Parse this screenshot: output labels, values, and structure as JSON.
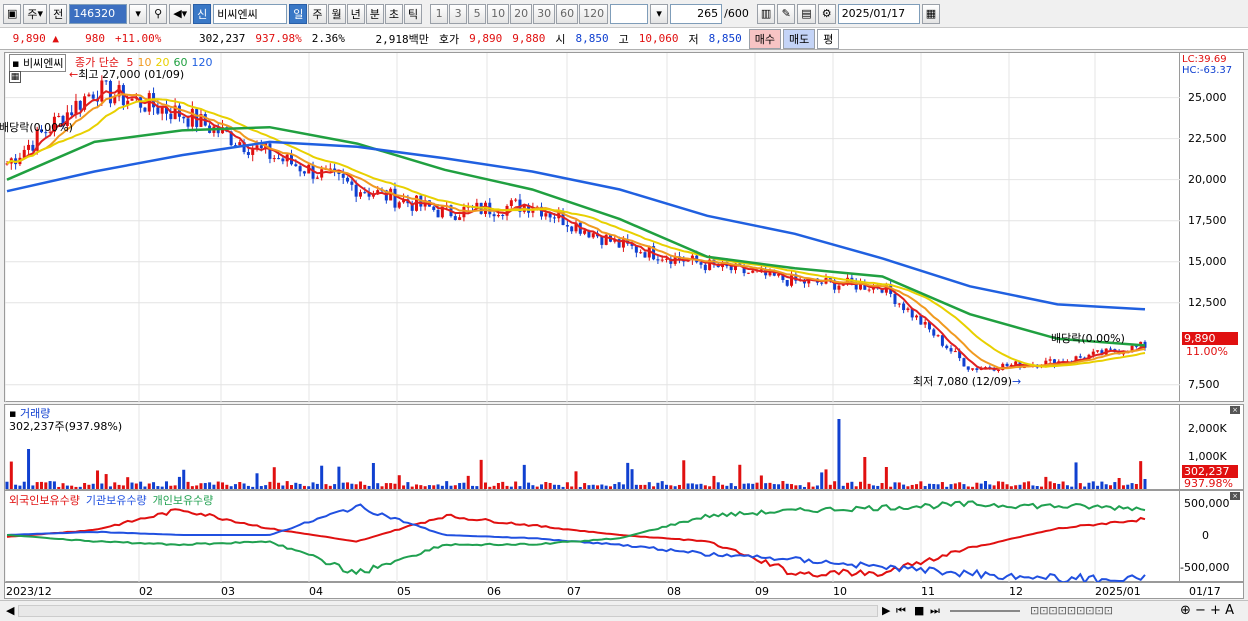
{
  "toolbar": {
    "market": "주",
    "prev_label": "전",
    "code": "146320",
    "badge": "신",
    "stock_name": "비씨엔씨",
    "periods": [
      "일",
      "주",
      "월",
      "년",
      "분",
      "초",
      "틱"
    ],
    "active_period": "일",
    "intervals": [
      "1",
      "3",
      "5",
      "10",
      "20",
      "30",
      "60",
      "120"
    ],
    "count": "265",
    "count_total": "/600",
    "date": "2025/01/17"
  },
  "quote": {
    "price": "9,890",
    "change": "980",
    "change_pct": "+11.00%",
    "volume": "302,237",
    "volume_ratio": "937.98%",
    "turnover": "2.36%",
    "amount": "2,918백만",
    "hoga_label": "호가",
    "ask": "9,890",
    "bid": "9,880",
    "open_label": "시",
    "open": "8,850",
    "high_label": "고",
    "high": "10,060",
    "low_label": "저",
    "low": "8,850",
    "buy_label": "매수",
    "sell_label": "매도",
    "eval_label": "평"
  },
  "price_panel": {
    "name": "비씨엔씨",
    "legend_title": "종가 단순",
    "ma": [
      {
        "period": "5",
        "color": "#e02020"
      },
      {
        "period": "10",
        "color": "#f09a20"
      },
      {
        "period": "20",
        "color": "#e8d000"
      },
      {
        "period": "60",
        "color": "#20a040"
      },
      {
        "period": "120",
        "color": "#2060e0"
      }
    ],
    "high_marker": "최고 27,000 (01/09)",
    "low_marker": "최저 7,080 (12/09)",
    "dividend_left": "배당락(0.00%)",
    "dividend_right": "배당락(0.00%)",
    "lc": "LC:39.69",
    "hc": "HC:-63.37",
    "y_ticks": [
      "25,000",
      "22,500",
      "20,000",
      "17,500",
      "15,000",
      "12,500",
      "7,500"
    ],
    "current_price": "9,890",
    "current_pct": "11.00%"
  },
  "volume_panel": {
    "title": "거래량",
    "value_label": "302,237주(937.98%)",
    "y_ticks": [
      "2,000K",
      "1,000K"
    ],
    "current": "302,237",
    "current_pct": "937.98%"
  },
  "holding_panel": {
    "legends": [
      "외국인보유수량",
      "기관보유수량",
      "개인보유수량"
    ],
    "colors": [
      "#e01010",
      "#2050e0",
      "#20a050"
    ],
    "y_ticks": [
      "500,000",
      "0",
      "-500,000"
    ]
  },
  "x_axis": {
    "labels": [
      "2023/12",
      "02",
      "03",
      "04",
      "05",
      "06",
      "07",
      "08",
      "09",
      "10",
      "11",
      "12",
      "2025/01"
    ],
    "right_label": "01/17"
  },
  "chart_data": {
    "type": "line",
    "title": "비씨엔씨",
    "x": [
      "2023/12",
      "02",
      "03",
      "04",
      "05",
      "06",
      "07",
      "08",
      "09",
      "10",
      "11",
      "12",
      "2025/01",
      "01/17"
    ],
    "series": [
      {
        "name": "종가",
        "values": [
          21000,
          25500,
          24000,
          21500,
          19500,
          18000,
          18500,
          16000,
          14800,
          13800,
          13500,
          8500,
          8900,
          9890
        ]
      },
      {
        "name": "120",
        "values": [
          19300,
          20500,
          21500,
          22300,
          22000,
          21300,
          20500,
          19400,
          17800,
          16700,
          15200,
          13500,
          12400,
          12100
        ]
      },
      {
        "name": "60",
        "values": [
          20000,
          22300,
          23000,
          23200,
          22200,
          20600,
          19400,
          17600,
          15300,
          14600,
          14100,
          11800,
          10300,
          9900
        ]
      }
    ],
    "ylim": [
      7000,
      26500
    ]
  }
}
